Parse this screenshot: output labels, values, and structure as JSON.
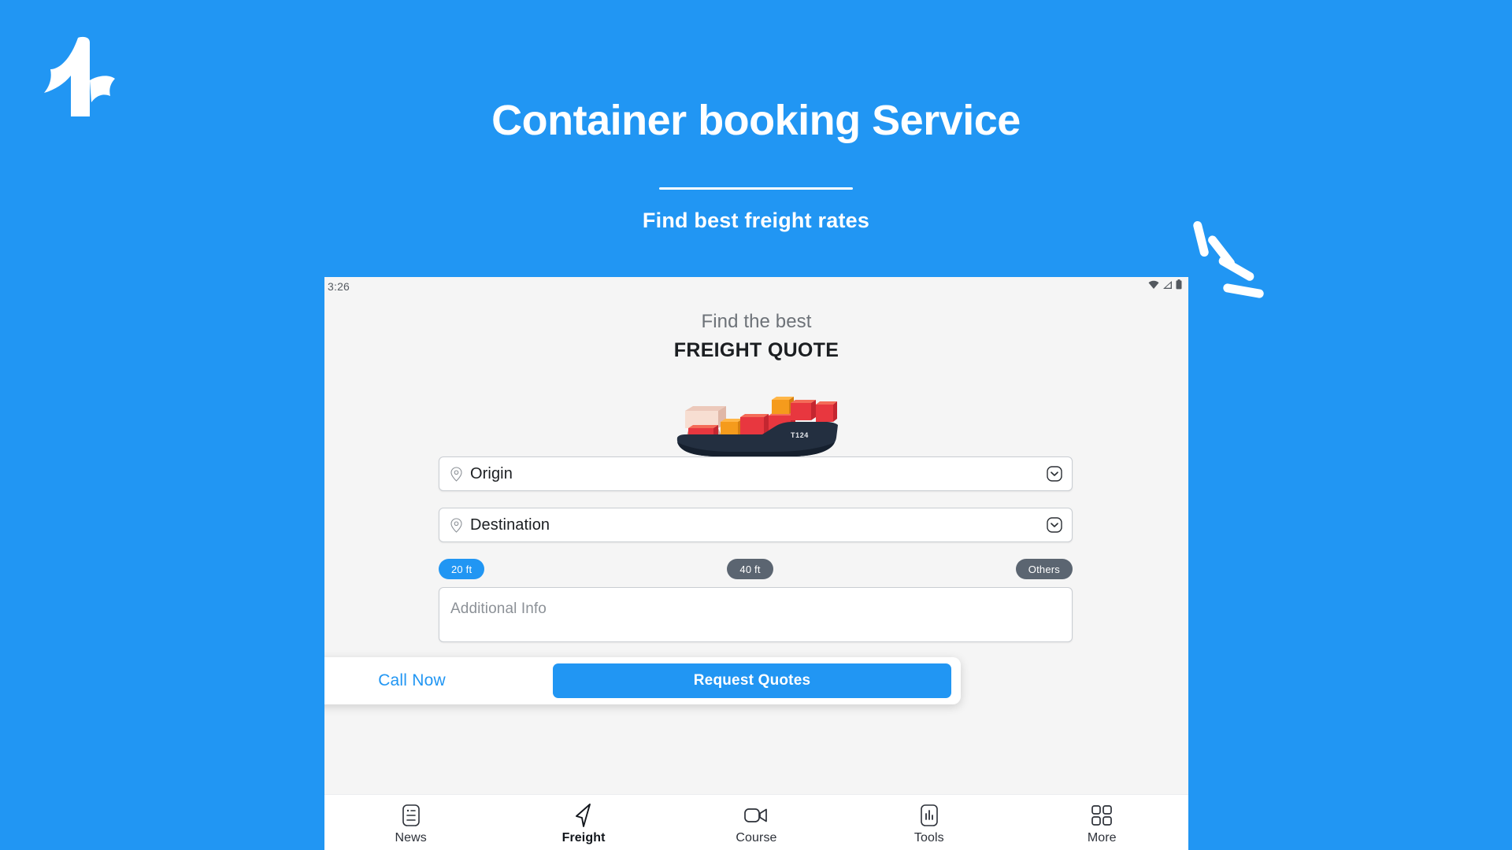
{
  "promo": {
    "title": "Container booking Service",
    "subtitle": "Find best freight rates",
    "logo_icon": "flag-one-logo",
    "sparkle_icon": "sparkle-burst-icon",
    "bg_color": "#2196f3",
    "text_color": "#ffffff"
  },
  "device": {
    "statusbar": {
      "time": "3:26",
      "icons": [
        "wifi-icon",
        "signal-icon",
        "battery-icon"
      ]
    },
    "header": {
      "eyebrow": "Find the best",
      "title": "FREIGHT QUOTE"
    },
    "illustration": {
      "name": "cargo-ship-illustration",
      "hull_label": "T124",
      "hull_color": "#1f2a3a",
      "container_colors": [
        "#e8373f",
        "#f59b1c",
        "#f4d4c6"
      ]
    },
    "form": {
      "origin": {
        "placeholder": "Origin",
        "value": "",
        "leading_icon": "location-pin-icon",
        "trailing_icon": "chevron-down-icon"
      },
      "destination": {
        "placeholder": "Destination",
        "value": "",
        "leading_icon": "location-pin-icon",
        "trailing_icon": "chevron-down-icon"
      },
      "container_sizes": [
        {
          "label": "20 ft",
          "selected": true
        },
        {
          "label": "40 ft",
          "selected": false
        },
        {
          "label": "Others",
          "selected": false
        }
      ],
      "selected_color": "#2196f3",
      "unselected_color": "#5b6571",
      "additional_info": {
        "placeholder": "Additional Info",
        "value": ""
      }
    },
    "obscured_text": "— .. —",
    "actionbar": {
      "call_label": "Call Now",
      "quotes_label": "Request Quotes",
      "call_color": "#2196f3",
      "quotes_bg": "#2196f3"
    },
    "bottomnav": {
      "items": [
        {
          "label": "News",
          "icon": "news-document-icon",
          "active": false
        },
        {
          "label": "Freight",
          "icon": "navigation-arrow-icon",
          "active": true
        },
        {
          "label": "Course",
          "icon": "video-camera-icon",
          "active": false
        },
        {
          "label": "Tools",
          "icon": "bar-chart-icon",
          "active": false
        },
        {
          "label": "More",
          "icon": "grid-squares-icon",
          "active": false
        }
      ]
    }
  }
}
